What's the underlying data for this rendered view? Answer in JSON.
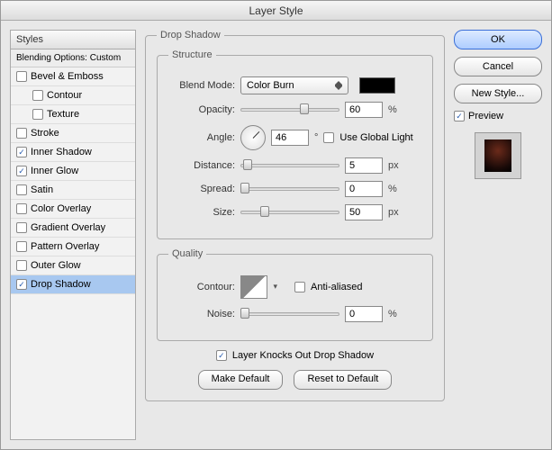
{
  "title": "Layer Style",
  "sidebar": {
    "header": "Styles",
    "sub": "Blending Options: Custom",
    "items": [
      {
        "label": "Bevel & Emboss",
        "checked": false,
        "indent": false,
        "selected": false
      },
      {
        "label": "Contour",
        "checked": false,
        "indent": true,
        "selected": false
      },
      {
        "label": "Texture",
        "checked": false,
        "indent": true,
        "selected": false
      },
      {
        "label": "Stroke",
        "checked": false,
        "indent": false,
        "selected": false
      },
      {
        "label": "Inner Shadow",
        "checked": true,
        "indent": false,
        "selected": false
      },
      {
        "label": "Inner Glow",
        "checked": true,
        "indent": false,
        "selected": false
      },
      {
        "label": "Satin",
        "checked": false,
        "indent": false,
        "selected": false
      },
      {
        "label": "Color Overlay",
        "checked": false,
        "indent": false,
        "selected": false
      },
      {
        "label": "Gradient Overlay",
        "checked": false,
        "indent": false,
        "selected": false
      },
      {
        "label": "Pattern Overlay",
        "checked": false,
        "indent": false,
        "selected": false
      },
      {
        "label": "Outer Glow",
        "checked": false,
        "indent": false,
        "selected": false
      },
      {
        "label": "Drop Shadow",
        "checked": true,
        "indent": false,
        "selected": true
      }
    ]
  },
  "panel": {
    "title": "Drop Shadow",
    "structure": {
      "legend": "Structure",
      "blend_mode_label": "Blend Mode:",
      "blend_mode_value": "Color Burn",
      "color": "#000000",
      "opacity_label": "Opacity:",
      "opacity_value": "60",
      "opacity_unit": "%",
      "angle_label": "Angle:",
      "angle_value": "46",
      "angle_unit": "°",
      "global_light_label": "Use Global Light",
      "global_light_checked": false,
      "distance_label": "Distance:",
      "distance_value": "5",
      "distance_unit": "px",
      "spread_label": "Spread:",
      "spread_value": "0",
      "spread_unit": "%",
      "size_label": "Size:",
      "size_value": "50",
      "size_unit": "px"
    },
    "quality": {
      "legend": "Quality",
      "contour_label": "Contour:",
      "anti_aliased_label": "Anti-aliased",
      "anti_aliased_checked": false,
      "noise_label": "Noise:",
      "noise_value": "0",
      "noise_unit": "%"
    },
    "knocks_out_label": "Layer Knocks Out Drop Shadow",
    "knocks_out_checked": true,
    "make_default": "Make Default",
    "reset_default": "Reset to Default"
  },
  "buttons": {
    "ok": "OK",
    "cancel": "Cancel",
    "new_style": "New Style...",
    "preview_label": "Preview",
    "preview_checked": true
  }
}
